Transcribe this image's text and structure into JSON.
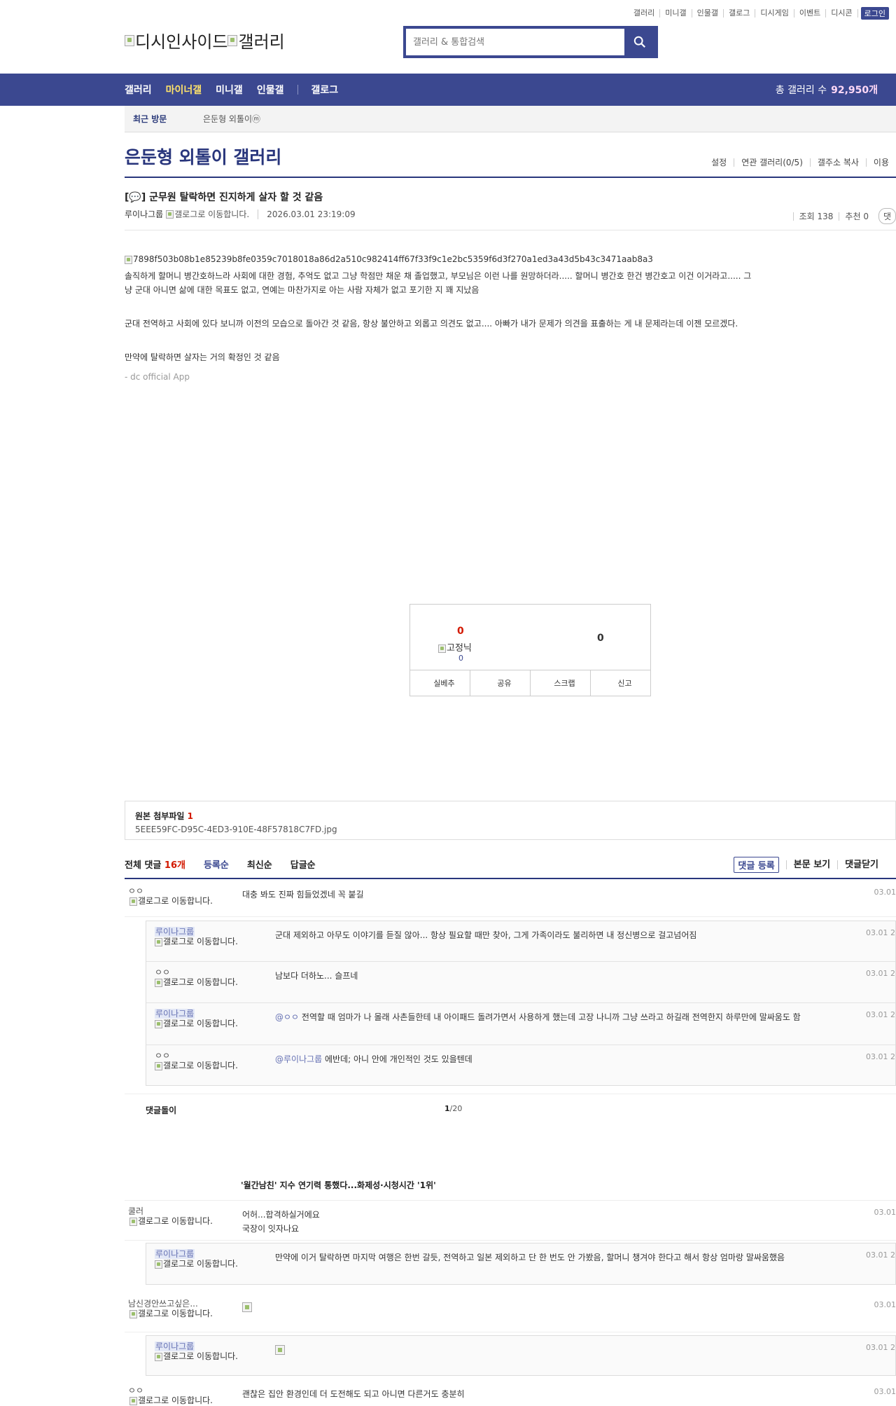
{
  "util_links": [
    "갤러리",
    "미니갤",
    "인물갤",
    "갤로그",
    "디시게임",
    "이벤트",
    "디시콘"
  ],
  "login_label": "로그인",
  "logo": {
    "alt_1": "디시인사이드",
    "alt_2": "갤러리"
  },
  "search": {
    "placeholder": "갤러리 & 통합검색"
  },
  "nav": {
    "items": [
      "갤러리",
      "마이너갤",
      "미니갤",
      "인물갤",
      "갤로그"
    ],
    "total_label": "총 갤러리 수",
    "total_value": "92,950개"
  },
  "recent": {
    "label": "최근 방문",
    "item": "은둔형 외톨이ⓜ"
  },
  "gallery": {
    "title": "은둔형 외톨이 갤러리",
    "options": [
      "설정",
      "연관 갤러리(0/5)",
      "갤주소 복사",
      "이용"
    ]
  },
  "post": {
    "title": "[💬] 군무원 탈락하면 진지하게 살자 할 것 같음",
    "writer": "루이나그룹",
    "gallog_alt": "갤로그로 이동합니다.",
    "date": "2026.03.01 23:19:09",
    "views": "조회 138",
    "recommend": "추천 0",
    "comment_btn": "댓",
    "image_alt": "7898f503b08b1e85239b8fe0359c7018018a86d2a510c982414ff67f33f9c1e2bc5359f6d3f270a1ed3a43d5b43c3471aab8a3",
    "para1": "솔직하게 할머니 병간호하느라 사회에 대한 경험, 추억도 없고 그냥 학점만 채운 채 졸업했고, 부모님은 이런 나를 원망하더라..... 할머니 병간호 한건 병간호고 이건 이거라고..... 그냥 군대 아니면 삶에 대한 목표도 없고, 연예는 마찬가지로 아는 사람 자체가 없고 포기한 지 꽤 지났음",
    "para2": "군대 전역하고 사회에 있다 보니까 이전의 모습으로 돌아간 것 같음, 항상 불안하고 외롭고 의견도 없고.... 아빠가 내가 문제가 의견을 표출하는 게 내 문제라는데 이젠 모르겠다.",
    "para3": "만약에 탈락하면 살자는 거의 확정인 것 같음",
    "signature": "- dc official App"
  },
  "recommend_box": {
    "up_count": "0",
    "fix_label": "고정닉",
    "fix_count": "0",
    "down_count": "0",
    "buttons": [
      "실베추",
      "공유",
      "스크랩",
      "신고"
    ]
  },
  "attach": {
    "label": "원본 첨부파일",
    "count": "1",
    "file": "5EEE59FC-D95C-4ED3-910E-48F57818C7FD.jpg"
  },
  "comments_header": {
    "label": "전체 댓글",
    "count": "16개",
    "sorts": [
      "등록순",
      "최신순",
      "답글순"
    ],
    "actions": [
      "댓글 등록",
      "본문 보기",
      "댓글닫기"
    ]
  },
  "gallog_alt": "갤로그로 이동합니다.",
  "comments": [
    {
      "nick": "ㅇㅇ",
      "text": "대충 봐도 진짜 힘들었겠네 꼭 붙길",
      "date": "03.01"
    },
    {
      "nick": "루이나그룹",
      "text": "군대 제외하고 아무도 이야기를 듣질 않아... 항상 필요할 때만 찾아, 그게 가족이라도 불리하면 내 정신병으로 걸고넘어짐",
      "date": "03.01 2"
    },
    {
      "nick": "ㅇㅇ",
      "text": "남보다 더하노... 슬프네",
      "date": "03.01 2"
    },
    {
      "nick": "루이나그룹",
      "mention": "@ㅇㅇ",
      "text": " 전역할 때 엄마가 나 몰래 사촌들한테 내 아이패드 돌려가면서 사용하게 했는데 고장 나니까 그냥 쓰라고 하길래 전역한지 하루만에 말싸움도 함",
      "date": "03.01 2"
    },
    {
      "nick": "ㅇㅇ",
      "mention": "@루이나그룹",
      "text": " 에반데; 아니 안에 개인적인 것도 있을텐데",
      "date": "03.01 2"
    }
  ],
  "comments_footer": {
    "fold": "댓글돌이",
    "page": "1",
    "total": "/20"
  },
  "news": "'월간남친' 지수 연기력 통했다...화제성·시청시간 '1위'",
  "comments2": [
    {
      "nick": "쿨러",
      "text": "어허...합격하실거에요",
      "text2": "국장이 잇자나요",
      "date": "03.01"
    },
    {
      "nick": "루이나그룹",
      "text": "만약에 이거 탈락하면 마지막 여행은 한번 갈듯, 전역하고 일본 제외하고 단 한 번도 안 가봤음, 할머니 챙겨야 한다고 해서 항상 엄마랑 말싸움했음",
      "date": "03.01 2"
    },
    {
      "nick": "남신경안쓰고싶은...",
      "date": "03.01"
    },
    {
      "nick": "루이나그룹",
      "date": "03.01 2"
    },
    {
      "nick": "ㅇㅇ",
      "text": "괜찮은 집안 환경인데 더 도전해도 되고 아니면 다른거도 충분히",
      "date": "03.01"
    }
  ]
}
